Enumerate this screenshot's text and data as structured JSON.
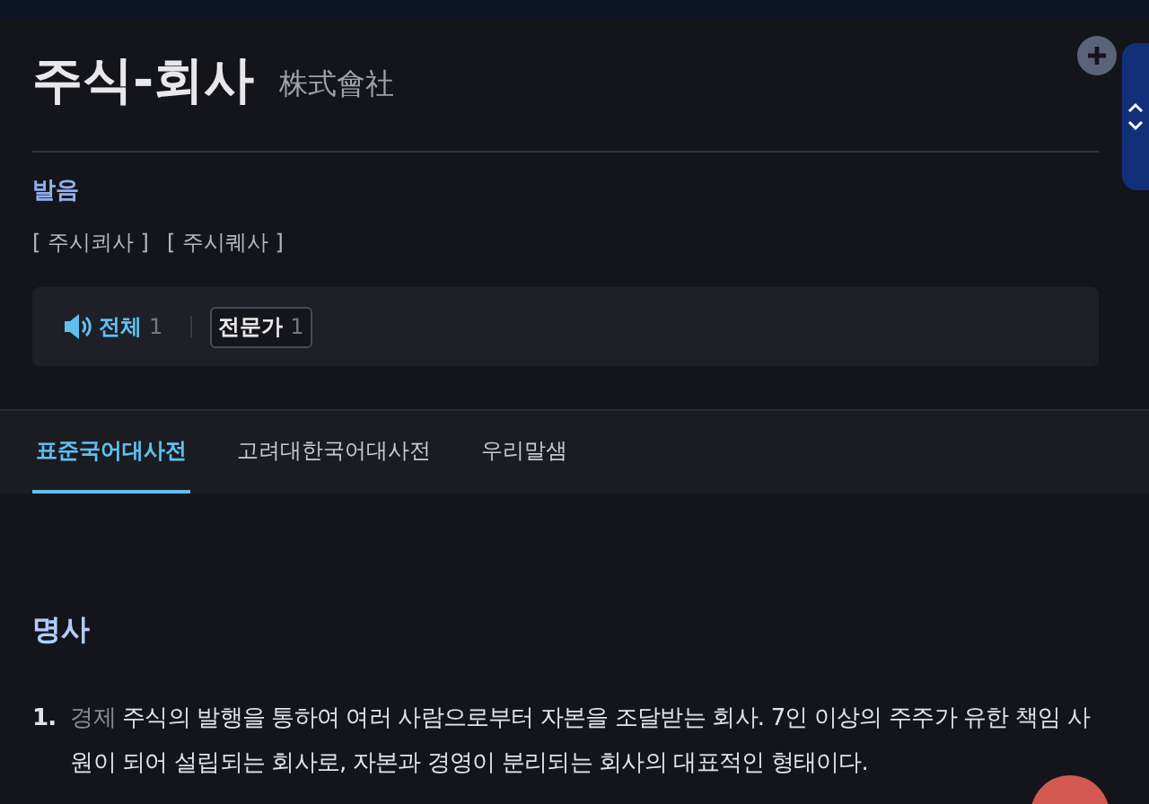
{
  "entry": {
    "headword": "주식-회사",
    "hanja": "株式會社"
  },
  "pronunciation": {
    "label": "발음",
    "forms": [
      "[ 주시쾨사 ]",
      "[ 주시퀘사 ]"
    ]
  },
  "audio": {
    "filters": [
      {
        "label": "전체",
        "count": "1",
        "selected": true
      },
      {
        "label": "전문가",
        "count": "1",
        "selected": false
      }
    ]
  },
  "tabs": [
    {
      "label": "표준국어대사전",
      "selected": true
    },
    {
      "label": "고려대한국어대사전",
      "selected": false
    },
    {
      "label": "우리말샘",
      "selected": false
    }
  ],
  "sense": {
    "pos": "명사",
    "definitions": [
      {
        "number": "1.",
        "field": "경제",
        "text": "주식의 발행을 통하여 여러 사람으로부터 자본을 조달받는 회사. 7인 이상의 주주가 유한 책임 사원이 되어 설립되는 회사로, 자본과 경영이 분리되는 회사의 대표적인 형태이다."
      }
    ]
  }
}
